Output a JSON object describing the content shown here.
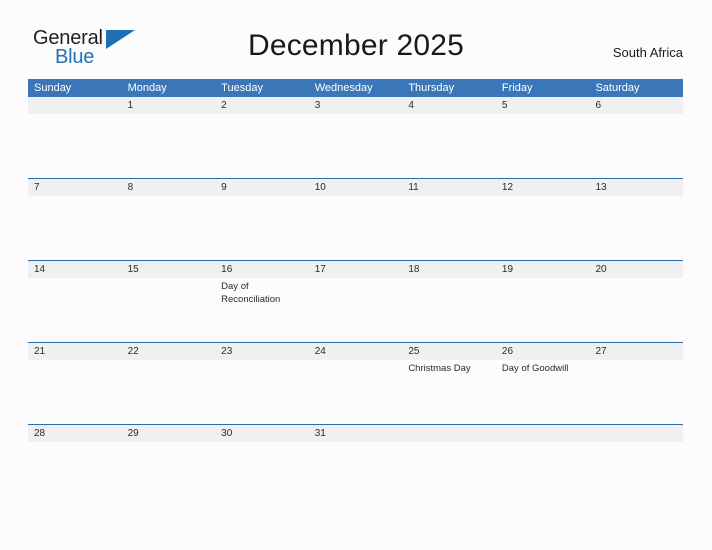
{
  "brand": {
    "name_part1": "General",
    "name_part2": "Blue",
    "triangle_icon": "triangle-icon",
    "accent_color": "#2470b8"
  },
  "header": {
    "title": "December 2025",
    "region": "South Africa"
  },
  "calendar": {
    "header_color": "#3a76b8",
    "date_band_color": "#f0f0f0",
    "row_line_color": "#2b6caa",
    "weekdays": [
      "Sunday",
      "Monday",
      "Tuesday",
      "Wednesday",
      "Thursday",
      "Friday",
      "Saturday"
    ],
    "weeks": [
      {
        "days": [
          {
            "date": "",
            "events": []
          },
          {
            "date": "1",
            "events": []
          },
          {
            "date": "2",
            "events": []
          },
          {
            "date": "3",
            "events": []
          },
          {
            "date": "4",
            "events": []
          },
          {
            "date": "5",
            "events": []
          },
          {
            "date": "6",
            "events": []
          }
        ]
      },
      {
        "days": [
          {
            "date": "7",
            "events": []
          },
          {
            "date": "8",
            "events": []
          },
          {
            "date": "9",
            "events": []
          },
          {
            "date": "10",
            "events": []
          },
          {
            "date": "11",
            "events": []
          },
          {
            "date": "12",
            "events": []
          },
          {
            "date": "13",
            "events": []
          }
        ]
      },
      {
        "days": [
          {
            "date": "14",
            "events": []
          },
          {
            "date": "15",
            "events": []
          },
          {
            "date": "16",
            "events": [
              "Day of Reconciliation"
            ]
          },
          {
            "date": "17",
            "events": []
          },
          {
            "date": "18",
            "events": []
          },
          {
            "date": "19",
            "events": []
          },
          {
            "date": "20",
            "events": []
          }
        ]
      },
      {
        "days": [
          {
            "date": "21",
            "events": []
          },
          {
            "date": "22",
            "events": []
          },
          {
            "date": "23",
            "events": []
          },
          {
            "date": "24",
            "events": []
          },
          {
            "date": "25",
            "events": [
              "Christmas Day"
            ]
          },
          {
            "date": "26",
            "events": [
              "Day of Goodwill"
            ]
          },
          {
            "date": "27",
            "events": []
          }
        ]
      },
      {
        "days": [
          {
            "date": "28",
            "events": []
          },
          {
            "date": "29",
            "events": []
          },
          {
            "date": "30",
            "events": []
          },
          {
            "date": "31",
            "events": []
          },
          {
            "date": "",
            "events": []
          },
          {
            "date": "",
            "events": []
          },
          {
            "date": "",
            "events": []
          }
        ]
      }
    ]
  }
}
